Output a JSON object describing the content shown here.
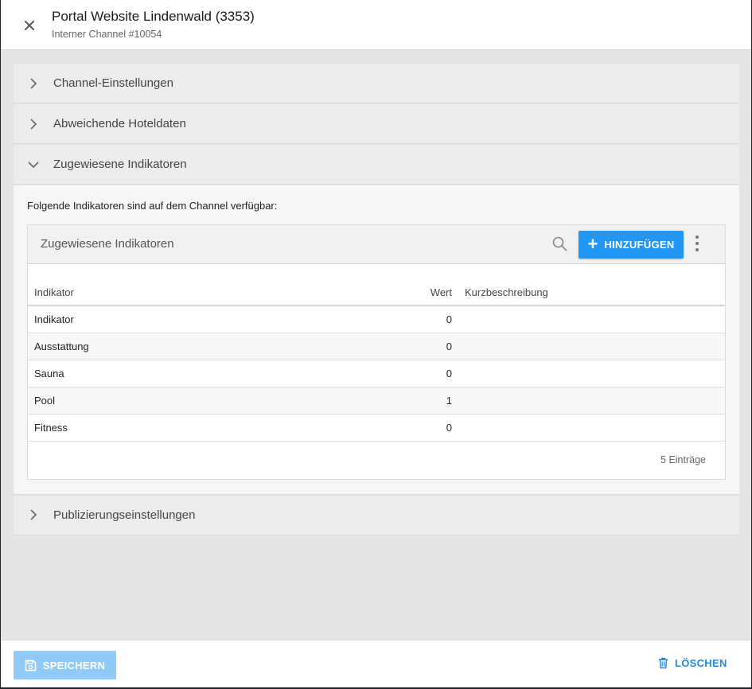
{
  "header": {
    "title": "Portal Website Lindenwald (3353)",
    "subtitle": "Interner Channel #10054"
  },
  "panels": [
    {
      "title": "Channel-Einstellungen",
      "expanded": false
    },
    {
      "title": "Abweichende Hoteldaten",
      "expanded": false
    },
    {
      "title": "Zugewiesene Indikatoren",
      "expanded": true
    },
    {
      "title": "Publizierungseinstellungen",
      "expanded": false
    }
  ],
  "indicators": {
    "intro": "Folgende Indikatoren sind auf dem Channel verfügbar:",
    "card_title": "Zugewiesene Indikatoren",
    "add_label": "HINZUFÜGEN",
    "columns": [
      "Indikator",
      "Wert",
      "Kurzbeschreibung"
    ],
    "rows": [
      [
        "Indikator",
        "0",
        ""
      ],
      [
        "Ausstattung",
        "0",
        ""
      ],
      [
        "Sauna",
        "0",
        ""
      ],
      [
        "Pool",
        "1",
        ""
      ],
      [
        "Fitness",
        "0",
        ""
      ]
    ],
    "entries": "5 Einträge"
  },
  "footer": {
    "save_label": "SPEICHERN",
    "delete_label": "LÖSCHEN"
  },
  "colors": {
    "accent": "#2196f3",
    "accent_disabled": "#90caf9",
    "delete_text": "#1e88e5"
  },
  "icons": [
    "close-icon",
    "chevron-right-icon",
    "chevron-down-icon",
    "search-icon",
    "plus-icon",
    "more-vert-icon",
    "save-icon",
    "trash-icon"
  ]
}
